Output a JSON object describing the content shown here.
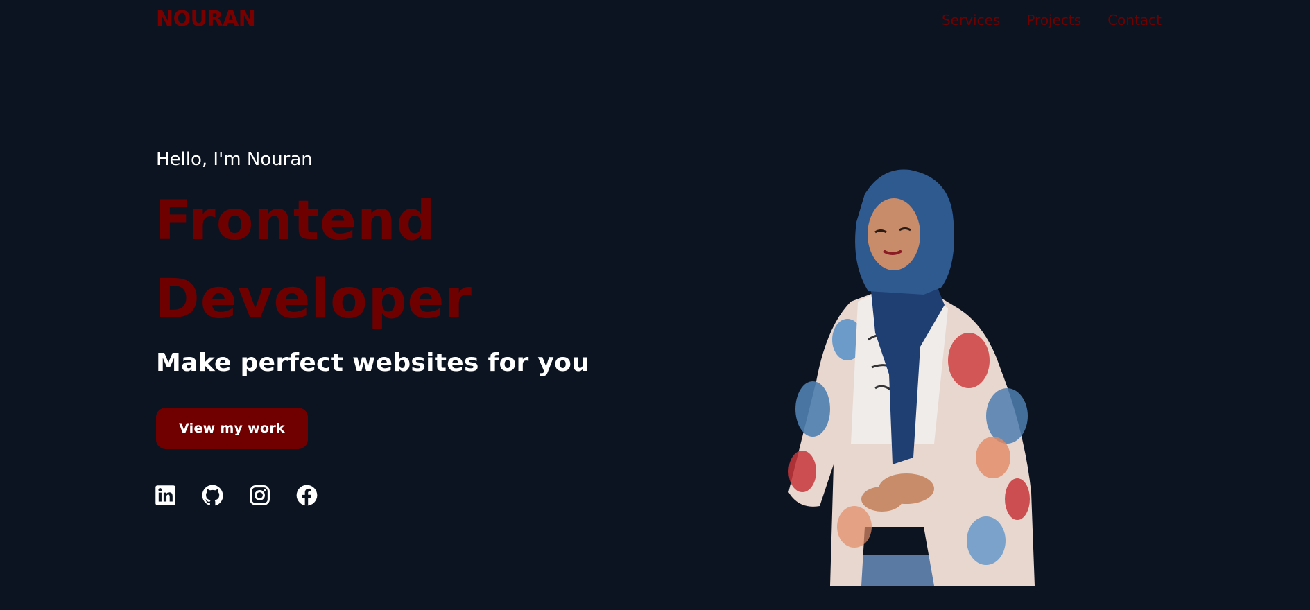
{
  "header": {
    "logo": "NOURAN",
    "nav": [
      "Services",
      "Projects",
      "Contact"
    ]
  },
  "hero": {
    "greeting": "Hello, I'm Nouran",
    "title_line1": "Frontend",
    "title_line2": "Developer",
    "tagline": "Make perfect websites for you",
    "cta_label": "View my work",
    "portrait_alt": "Nouran portrait"
  },
  "socials": [
    {
      "name": "linkedin-icon"
    },
    {
      "name": "github-icon"
    },
    {
      "name": "instagram-icon"
    },
    {
      "name": "facebook-icon"
    }
  ],
  "colors": {
    "background": "#0c1422",
    "accent": "#700000",
    "text": "#ffffff"
  }
}
